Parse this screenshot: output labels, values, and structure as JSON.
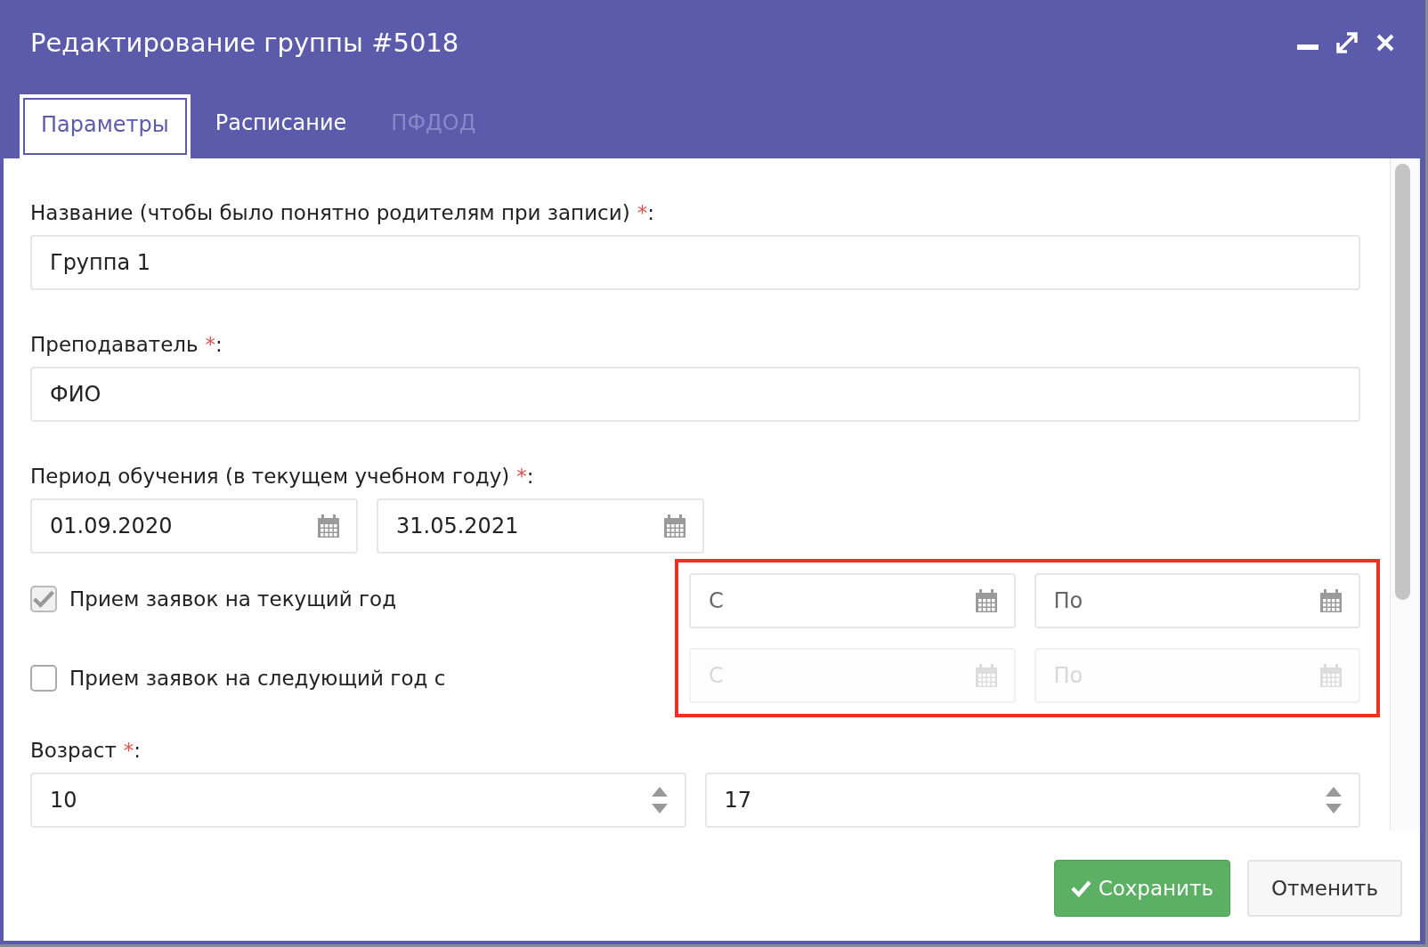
{
  "window": {
    "title": "Редактирование группы #5018"
  },
  "tabs": [
    {
      "label": "Параметры",
      "selected": true,
      "disabled": false
    },
    {
      "label": "Расписание",
      "selected": false,
      "disabled": false
    },
    {
      "label": "ПФДОД",
      "selected": false,
      "disabled": true
    }
  ],
  "name_field": {
    "label": "Название (чтобы было понятно родителям при записи)",
    "required_mark": "*",
    "separator": ":",
    "value": "Группа 1"
  },
  "teacher_field": {
    "label": "Преподаватель",
    "required_mark": "*",
    "separator": ":",
    "value": "ФИО"
  },
  "period": {
    "label": "Период обучения (в текущем учебном году)",
    "required_mark": "*",
    "separator": ":",
    "from": "01.09.2020",
    "to": "31.05.2021"
  },
  "enrollment": {
    "highlighted": true,
    "rows": [
      {
        "label": "Прием заявок на текущий год",
        "checked": true,
        "from_placeholder": "С",
        "to_placeholder": "По"
      },
      {
        "label": "Прием заявок на следующий год с",
        "checked": false,
        "from_placeholder": "С",
        "to_placeholder": "По"
      }
    ]
  },
  "age": {
    "label": "Возраст",
    "required_mark": "*",
    "separator": ":",
    "from": "10",
    "to": "17"
  },
  "buttons": [
    {
      "kind": "primary",
      "label": "Сохранить"
    },
    {
      "kind": "default",
      "label": "Отменить"
    }
  ]
}
